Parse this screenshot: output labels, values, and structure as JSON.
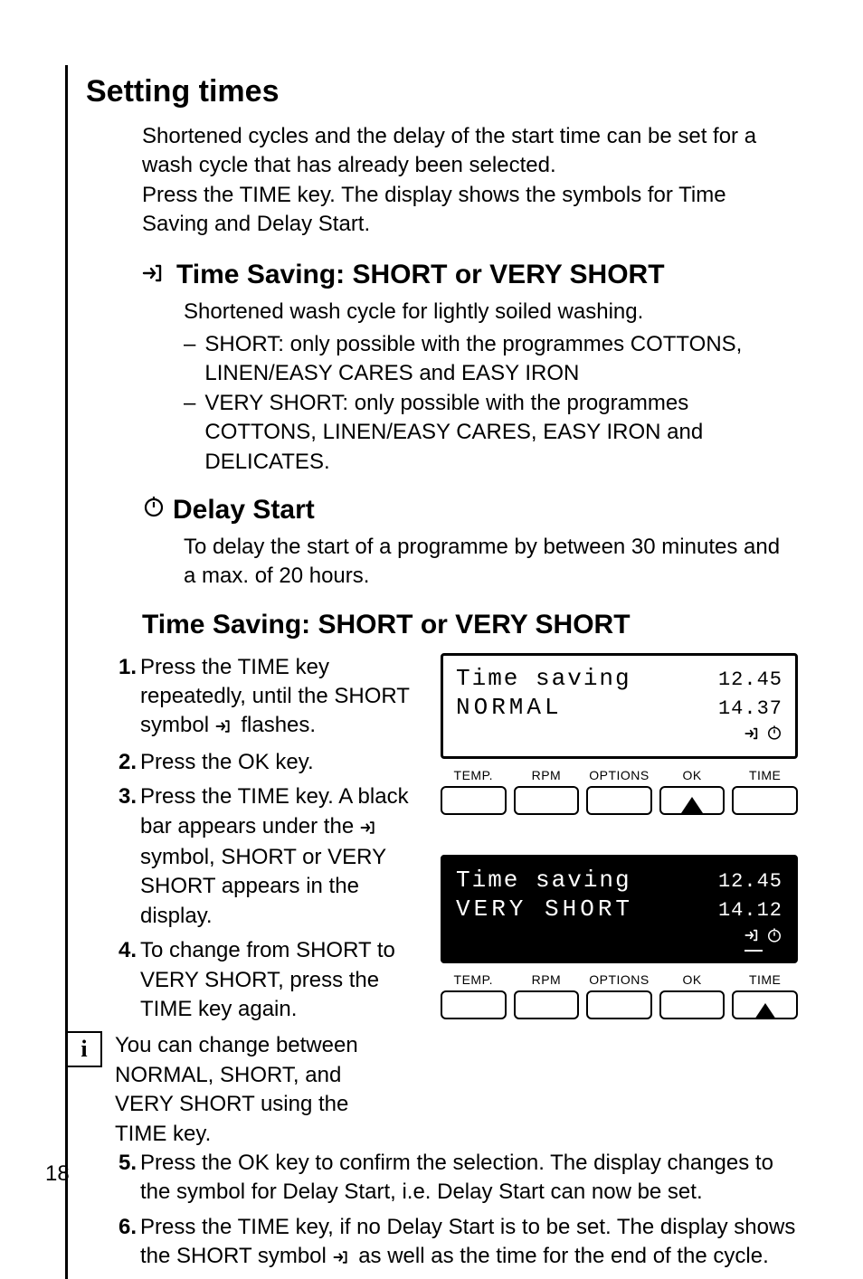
{
  "page_number": "18",
  "h1": "Setting times",
  "intro_p1": "Shortened cycles and the delay of the start time can be set for a wash cycle that has already been selected.",
  "intro_p2": "Press the TIME key. The display shows the symbols for Time Saving and Delay Start.",
  "sec_a_title": "Time Saving: SHORT or VERY SHORT",
  "sec_a_sub": "Shortened wash cycle for lightly soiled washing.",
  "sec_a_item1": "SHORT: only possible with the programmes COTTONS, LINEN/EASY CARES and EASY IRON",
  "sec_a_item2": "VERY SHORT: only possible with the programmes COTTONS, LINEN/EASY CARES, EASY IRON and DELICATES.",
  "sec_b_title": "Delay Start",
  "sec_b_sub": "To delay the start of a programme by between 30 minutes and a max. of 20 hours.",
  "sec_c_title": "Time Saving: SHORT or VERY SHORT",
  "steps": {
    "n1": "1.",
    "t1a": "Press the TIME key repeatedly, until the SHORT symbol ",
    "t1b": " flashes.",
    "n2": "2.",
    "t2": "Press the OK key.",
    "n3": "3.",
    "t3a": "Press the TIME key. A black bar appears under the ",
    "t3b": " symbol, SHORT or VERY SHORT appears in the display.",
    "n4": "4.",
    "t4": "To change from SHORT to VERY SHORT, press the TIME key again.",
    "info": "You can change between NORMAL, SHORT, and VERY SHORT using the TIME key.",
    "n5": "5.",
    "t5": "Press the OK key to confirm the selection. The display changes to the symbol for Delay Start, i.e. Delay Start can now be set.",
    "n6": "6.",
    "t6a": "Press the TIME key, if no Delay Start is to be set. The display shows the SHORT symbol ",
    "t6b": " as well as the time for the end of the cycle."
  },
  "panel1": {
    "title": "Time saving",
    "clock": "12.45",
    "mode": "NORMAL",
    "end": "14.37",
    "pointer_under": "OK"
  },
  "panel2": {
    "title": "Time saving",
    "clock": "12.45",
    "mode": "VERY SHORT",
    "end": "14.12",
    "pointer_under": "TIME"
  },
  "buttons": [
    "TEMP.",
    "RPM",
    "OPTIONS",
    "OK",
    "TIME"
  ]
}
